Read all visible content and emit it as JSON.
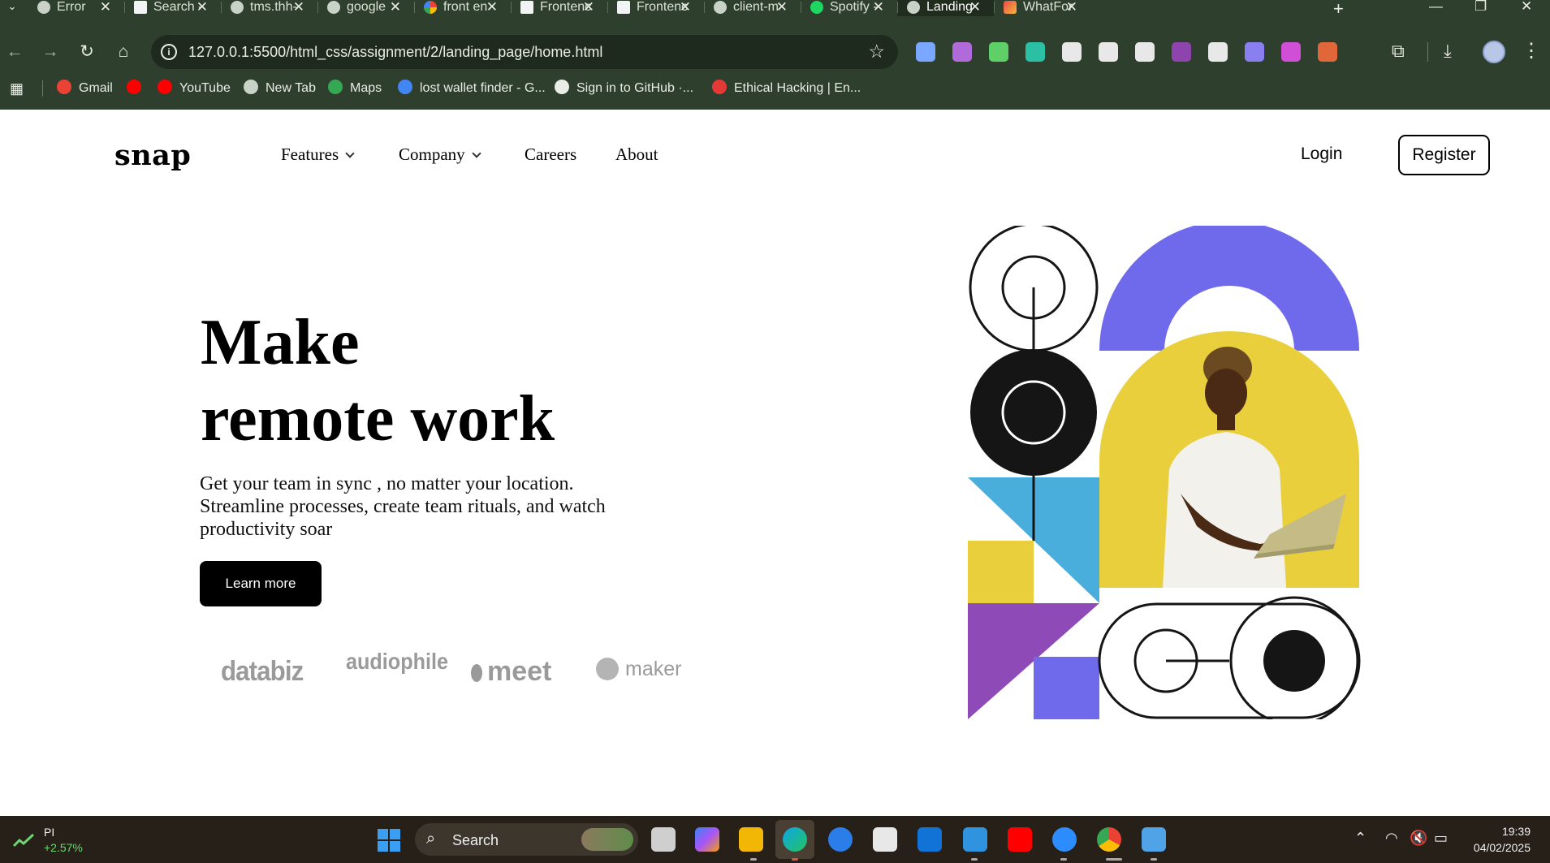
{
  "browser": {
    "tabs": [
      {
        "title": "Error",
        "icon": "globe-icon",
        "active": false
      },
      {
        "title": "Search - ",
        "icon": "doc-icon",
        "active": false
      },
      {
        "title": "tms.thh-",
        "icon": "globe-icon",
        "active": false
      },
      {
        "title": "google ",
        "icon": "globe-icon",
        "active": false
      },
      {
        "title": "front en",
        "icon": "google-icon",
        "active": false
      },
      {
        "title": "Frontenc",
        "icon": "doc-icon",
        "active": false
      },
      {
        "title": "Frontenc",
        "icon": "doc-icon",
        "active": false
      },
      {
        "title": "client-m",
        "icon": "globe-icon",
        "active": false
      },
      {
        "title": "Spotify - ",
        "icon": "spotify-icon",
        "active": false
      },
      {
        "title": "Landing",
        "icon": "globe-icon",
        "active": true
      },
      {
        "title": "WhatFor",
        "icon": "whatfor-icon",
        "active": false
      }
    ],
    "tab_close_glyph": "✕",
    "new_tab_glyph": "+",
    "address": "127.0.0.1:5500/html_css/assignment/2/landing_page/home.html",
    "bookmarks": [
      {
        "label": "Gmail",
        "color": "#ea4335"
      },
      {
        "label": "",
        "color": "#ff0000"
      },
      {
        "label": "YouTube",
        "color": "#ff0000"
      },
      {
        "label": "New Tab",
        "color": "#c9d2c6"
      },
      {
        "label": "Maps",
        "color": "#34a853"
      },
      {
        "label": "lost wallet finder - G...",
        "color": "#4285f4"
      },
      {
        "label": "Sign in to GitHub ·...",
        "color": "#e8ede6"
      },
      {
        "label": "Ethical Hacking | En...",
        "color": "#e53935"
      }
    ],
    "extension_colors": [
      "#7aa7ff",
      "#b06ad9",
      "#5fd068",
      "#2bbfa4",
      "#e8e8e8",
      "#e8e8e8",
      "#e8e8e8",
      "#8e44ad",
      "#e8e8e8",
      "#8a7ff0",
      "#d04fd6",
      "#e0673a"
    ]
  },
  "page": {
    "logo": "snap",
    "nav": {
      "features": "Features",
      "company": "Company",
      "careers": "Careers",
      "about": "About"
    },
    "auth": {
      "login": "Login",
      "register": "Register"
    },
    "hero": {
      "title_line1": "Make",
      "title_line2": "remote work",
      "description": "Get your team in sync , no matter your location. Streamline processes, create team rituals, and watch productivity soar",
      "cta": "Learn more"
    },
    "clients": [
      "databiz",
      "audiophile",
      "meet",
      "maker"
    ],
    "art_colors": {
      "purple": "#6e6aeb",
      "yellow": "#e9cf3b",
      "blue": "#4aaedc",
      "violet": "#8e4bb8",
      "black": "#151515"
    }
  },
  "taskbar": {
    "widget_name": "PI",
    "widget_value": "+2.57%",
    "search_label": "Search",
    "time": "19:39",
    "date": "04/02/2025",
    "accent_positive": "#6fd673"
  }
}
